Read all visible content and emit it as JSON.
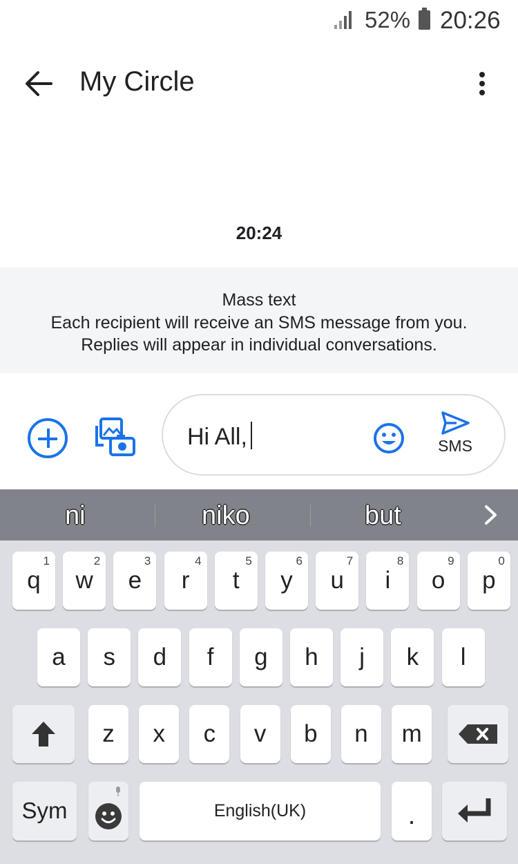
{
  "status_bar": {
    "battery": "52%",
    "time": "20:26"
  },
  "app_bar": {
    "title": "My Circle"
  },
  "conversation": {
    "timestamp": "20:24",
    "notice": {
      "title": "Mass text",
      "line1": "Each recipient will receive an SMS message from you.",
      "line2": "Replies will appear in individual conversations."
    }
  },
  "compose": {
    "text": "Hi All,",
    "send_label": "SMS"
  },
  "keyboard": {
    "suggestions": [
      "ni",
      "niko",
      "but"
    ],
    "row1": [
      {
        "key": "q",
        "num": "1"
      },
      {
        "key": "w",
        "num": "2"
      },
      {
        "key": "e",
        "num": "3"
      },
      {
        "key": "r",
        "num": "4"
      },
      {
        "key": "t",
        "num": "5"
      },
      {
        "key": "y",
        "num": "6"
      },
      {
        "key": "u",
        "num": "7"
      },
      {
        "key": "i",
        "num": "8"
      },
      {
        "key": "o",
        "num": "9"
      },
      {
        "key": "p",
        "num": "0"
      }
    ],
    "row2": [
      "a",
      "s",
      "d",
      "f",
      "g",
      "h",
      "j",
      "k",
      "l"
    ],
    "row3": [
      "z",
      "x",
      "c",
      "v",
      "b",
      "n",
      "m"
    ],
    "sym_label": "Sym",
    "space_label": "English(UK)",
    "period_label": "."
  },
  "colors": {
    "accent": "#1a73e8",
    "suggestion_bar": "#808389",
    "keyboard_bg": "#dcdee4",
    "notice_bg": "#f4f5f7"
  },
  "icons": {
    "back": "arrow-left-icon",
    "more": "more-vert-icon",
    "add": "add-circle-icon",
    "gallery": "gallery-camera-icon",
    "emoji": "emoji-icon",
    "send": "send-icon",
    "shift": "shift-icon",
    "backspace": "backspace-icon",
    "enter": "enter-icon",
    "mic": "mic-icon",
    "next": "chevron-right-icon"
  }
}
